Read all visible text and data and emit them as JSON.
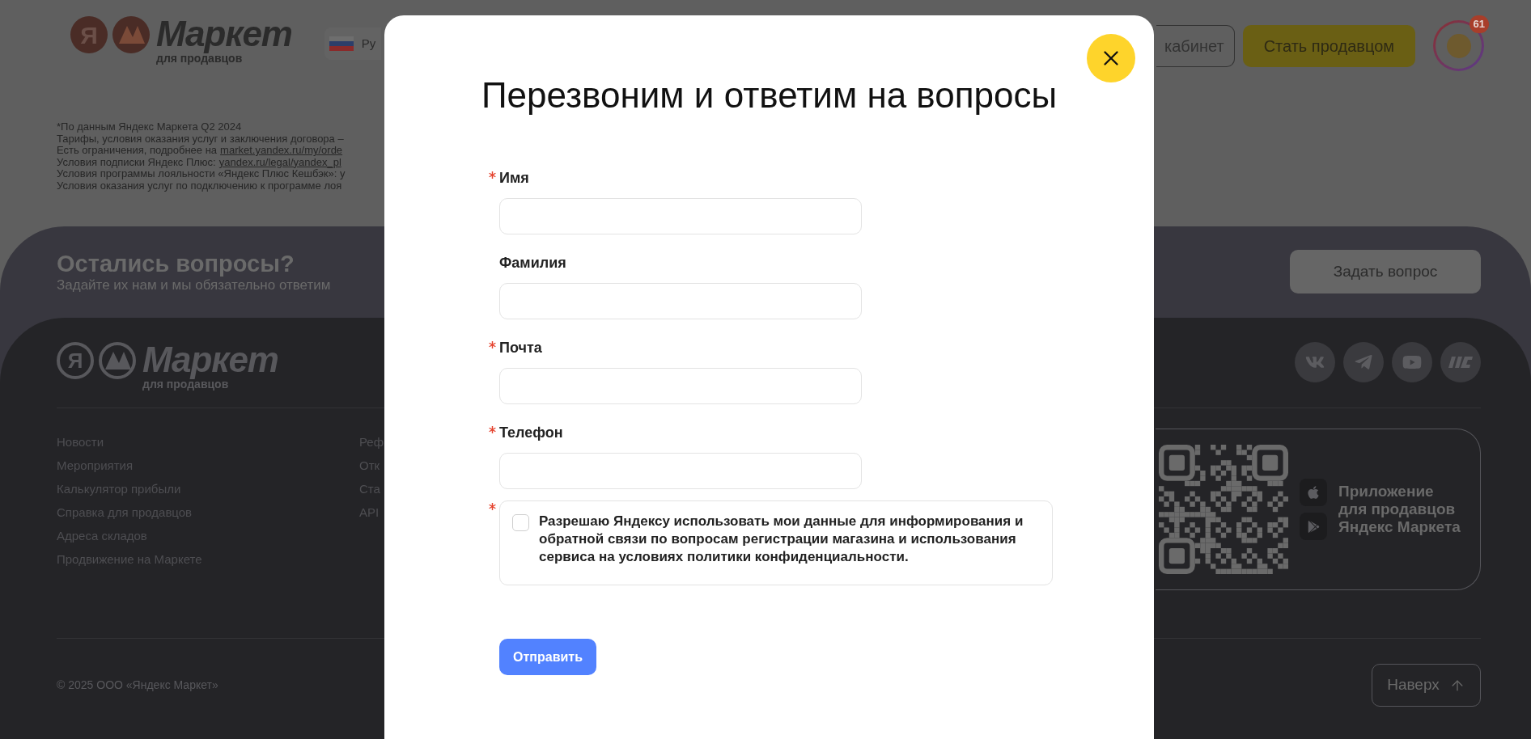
{
  "header": {
    "logo": {
      "mark": "Я",
      "wordmark": "Маркет",
      "subtitle": "для продавцов"
    },
    "language": "Ру",
    "buttons": [
      {
        "label": "кабинет",
        "kind": "outline"
      },
      {
        "label": "Стать продавцом",
        "kind": "primary"
      }
    ],
    "notifications_badge": "61"
  },
  "disclaimers": [
    {
      "parts": [
        {
          "text": "*По данным Яндекс Маркета Q2 2024",
          "link": false
        }
      ]
    },
    {
      "parts": [
        {
          "text": "Тарифы, условия оказания услуг и заключения договора –",
          "link": false
        }
      ]
    },
    {
      "parts": [
        {
          "text": "Есть ограничения, подробнее на",
          "link": false
        },
        {
          "text": "market.yandex.ru/my/orde",
          "link": true
        }
      ]
    },
    {
      "parts": [
        {
          "text": "Условия подписки Яндекс Плюс:",
          "link": false
        },
        {
          "text": "yandex.ru/legal/yandex_pl",
          "link": true
        }
      ]
    },
    {
      "parts": [
        {
          "text": "Условия программы лояльности «Яндекс Плюс Кешбэк»: у",
          "link": false
        }
      ]
    },
    {
      "parts": [
        {
          "text": "Условия оказания услуг по подключению к программе лоя",
          "link": false
        }
      ]
    }
  ],
  "questions_banner": {
    "title": "Остались вопросы?",
    "subtitle": "Задайте их нам и мы обязательно ответим",
    "button": "Задать вопрос"
  },
  "footer": {
    "logo": {
      "mark": "Я",
      "wordmark": "Маркет",
      "subtitle": "для продавцов"
    },
    "links_column_1": [
      "Новости",
      "Мероприятия",
      "Калькулятор прибыли",
      "Справка для продавцов",
      "Адреса складов",
      "Продвижение на Маркете"
    ],
    "links_column_2": [
      "Реф",
      "Отк",
      "Ста",
      "API"
    ],
    "app_promo": "Приложение\nдля продавцов\nЯндекс Маркета",
    "copyright": "© 2025 ООО «Яндекс Маркет»",
    "back_to_top": "Наверх"
  },
  "modal": {
    "title": "Перезвоним и ответим на вопросы",
    "fields": [
      {
        "label": "Имя",
        "required": true
      },
      {
        "label": "Фамилия",
        "required": false
      },
      {
        "label": "Почта",
        "required": true
      },
      {
        "label": "Телефон",
        "required": true
      }
    ],
    "consent": {
      "text": "Разрешаю Яндексу использовать мои данные для информирования и обратной связи по вопросам регистрации магазина и использования сервиса на условиях политики конфиденциальности.",
      "required": true,
      "checked": false
    },
    "submit": "Отправить"
  }
}
